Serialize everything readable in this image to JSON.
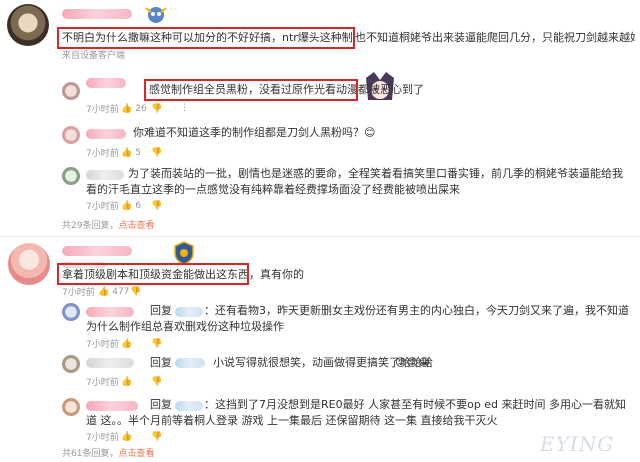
{
  "thread1": {
    "main": {
      "text_highlight": "不明白为什么撒嘛这种可以加分的不好好搞，ntr爆头这种制作组就如此情有独钟？",
      "text_tail": "也不知道桐姥爷出来装逼能爬回几分，只能祝刀剑越来越好了。",
      "meta": "来自设备客户端"
    },
    "replies": [
      {
        "text": "感觉制作组全员黑粉，没看过原作光看动漫都被恶心到了",
        "time": "7小时前",
        "likes": "26"
      },
      {
        "text": "你难道不知道这季的制作组都是刀剑人黑粉吗？😊",
        "time": "7小时前",
        "likes": "5"
      },
      {
        "text": "为了装而装站的一批，剧情也是迷惑的要命，全程笑着看搞笑里口番实锤，前几季的桐姥爷装逼能给我看的汗毛直立这季的一点感觉没有纯粹靠着经费撑场面没了经费能被喷出屎来",
        "time": "7小时前",
        "likes": "6"
      }
    ],
    "reply_count": "共29条回复，",
    "expand": "点击查看"
  },
  "thread2": {
    "main": {
      "text_highlight": "拿着顶级剧本和顶级资金能做出这东西，真有你的",
      "time": "7小时前",
      "likes": "477"
    },
    "replies": [
      {
        "label": "回复",
        "text": "：还有看物3，昨天更新删女主戏份还有男主的内心独白，今天刀剑又来了遍，我不知道为什么制作组总喜欢删戏份这种垃圾操作",
        "time": "7小时前",
        "likes": ""
      },
      {
        "label": "回复",
        "text": "小说写得就很想笑，动画做得更搞笑了哈哈哈",
        "emoji": "😡😡😂",
        "time": "7小时前",
        "likes": ""
      },
      {
        "label": "回复",
        "text": "：这挡到了7月没想到是RE0最好    人家甚至有时候不要op ed 来赶时间 多用心一看就知道 这。。半个月前等着桐人登录 游戏 上一集最后 还保留期待 这一集 直接给我干灭火",
        "time": "7小时前",
        "likes": ""
      }
    ],
    "reply_count": "共61条回复，",
    "expand": "点击查看"
  },
  "watermark": "EYING",
  "colors": {
    "highlight": "#d9262b",
    "link": "#eb7350"
  }
}
